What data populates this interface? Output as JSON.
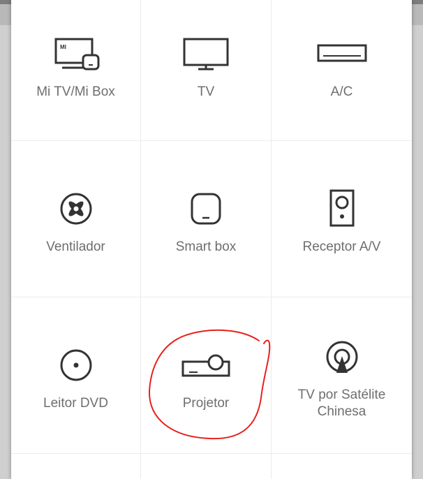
{
  "devices": [
    {
      "label": "Mi TV/Mi Box",
      "icon": "mi-tv-box-icon"
    },
    {
      "label": "TV",
      "icon": "tv-icon"
    },
    {
      "label": "A/C",
      "icon": "air-conditioner-icon"
    },
    {
      "label": "Ventilador",
      "icon": "fan-icon"
    },
    {
      "label": "Smart box",
      "icon": "smart-box-icon"
    },
    {
      "label": "Receptor A/V",
      "icon": "speaker-icon"
    },
    {
      "label": "Leitor DVD",
      "icon": "dvd-icon"
    },
    {
      "label": "Projetor",
      "icon": "projector-icon"
    },
    {
      "label_line1": "TV por Satélite",
      "label_line2": "Chinesa",
      "icon": "satellite-dish-icon"
    }
  ],
  "mi_logo_text": "MI",
  "colors": {
    "icon": "#333333",
    "label": "#6e6e6e",
    "annotation": "#e8201c",
    "divider": "#ececec"
  }
}
